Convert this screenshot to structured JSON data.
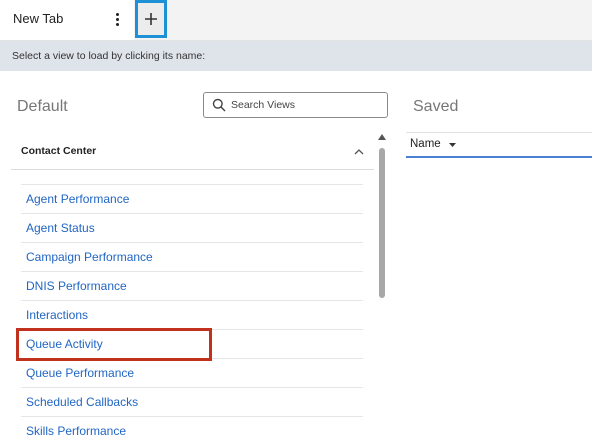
{
  "tab": {
    "title": "New Tab"
  },
  "banner": {
    "text": "Select a view to load by clicking its name:"
  },
  "default_panel": {
    "title": "Default",
    "search_placeholder": "Search Views",
    "group": {
      "label": "Contact Center",
      "items": [
        "Agent Performance",
        "Agent Status",
        "Campaign Performance",
        "DNIS Performance",
        "Interactions",
        "Queue Activity",
        "Queue Performance",
        "Scheduled Callbacks",
        "Skills Performance"
      ]
    }
  },
  "saved_panel": {
    "title": "Saved",
    "column": "Name"
  },
  "colors": {
    "accent_blue": "#1e90d6",
    "link_blue": "#2266c4",
    "highlight_red": "#c0321e",
    "sort_underline": "#4a7fd6"
  }
}
